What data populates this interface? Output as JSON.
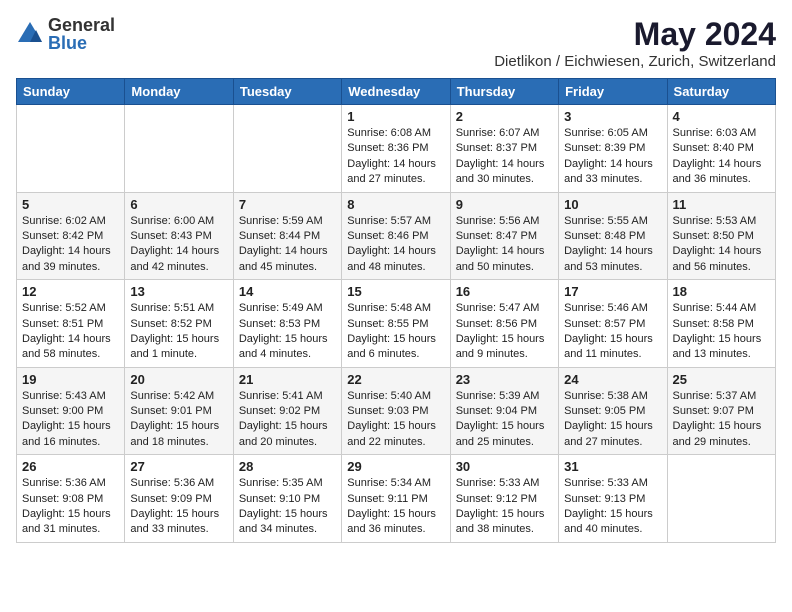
{
  "logo": {
    "general": "General",
    "blue": "Blue"
  },
  "title": "May 2024",
  "location": "Dietlikon / Eichwiesen, Zurich, Switzerland",
  "days_of_week": [
    "Sunday",
    "Monday",
    "Tuesday",
    "Wednesday",
    "Thursday",
    "Friday",
    "Saturday"
  ],
  "weeks": [
    [
      {
        "day": "",
        "data": ""
      },
      {
        "day": "",
        "data": ""
      },
      {
        "day": "",
        "data": ""
      },
      {
        "day": "1",
        "data": "Sunrise: 6:08 AM\nSunset: 8:36 PM\nDaylight: 14 hours and 27 minutes."
      },
      {
        "day": "2",
        "data": "Sunrise: 6:07 AM\nSunset: 8:37 PM\nDaylight: 14 hours and 30 minutes."
      },
      {
        "day": "3",
        "data": "Sunrise: 6:05 AM\nSunset: 8:39 PM\nDaylight: 14 hours and 33 minutes."
      },
      {
        "day": "4",
        "data": "Sunrise: 6:03 AM\nSunset: 8:40 PM\nDaylight: 14 hours and 36 minutes."
      }
    ],
    [
      {
        "day": "5",
        "data": "Sunrise: 6:02 AM\nSunset: 8:42 PM\nDaylight: 14 hours and 39 minutes."
      },
      {
        "day": "6",
        "data": "Sunrise: 6:00 AM\nSunset: 8:43 PM\nDaylight: 14 hours and 42 minutes."
      },
      {
        "day": "7",
        "data": "Sunrise: 5:59 AM\nSunset: 8:44 PM\nDaylight: 14 hours and 45 minutes."
      },
      {
        "day": "8",
        "data": "Sunrise: 5:57 AM\nSunset: 8:46 PM\nDaylight: 14 hours and 48 minutes."
      },
      {
        "day": "9",
        "data": "Sunrise: 5:56 AM\nSunset: 8:47 PM\nDaylight: 14 hours and 50 minutes."
      },
      {
        "day": "10",
        "data": "Sunrise: 5:55 AM\nSunset: 8:48 PM\nDaylight: 14 hours and 53 minutes."
      },
      {
        "day": "11",
        "data": "Sunrise: 5:53 AM\nSunset: 8:50 PM\nDaylight: 14 hours and 56 minutes."
      }
    ],
    [
      {
        "day": "12",
        "data": "Sunrise: 5:52 AM\nSunset: 8:51 PM\nDaylight: 14 hours and 58 minutes."
      },
      {
        "day": "13",
        "data": "Sunrise: 5:51 AM\nSunset: 8:52 PM\nDaylight: 15 hours and 1 minute."
      },
      {
        "day": "14",
        "data": "Sunrise: 5:49 AM\nSunset: 8:53 PM\nDaylight: 15 hours and 4 minutes."
      },
      {
        "day": "15",
        "data": "Sunrise: 5:48 AM\nSunset: 8:55 PM\nDaylight: 15 hours and 6 minutes."
      },
      {
        "day": "16",
        "data": "Sunrise: 5:47 AM\nSunset: 8:56 PM\nDaylight: 15 hours and 9 minutes."
      },
      {
        "day": "17",
        "data": "Sunrise: 5:46 AM\nSunset: 8:57 PM\nDaylight: 15 hours and 11 minutes."
      },
      {
        "day": "18",
        "data": "Sunrise: 5:44 AM\nSunset: 8:58 PM\nDaylight: 15 hours and 13 minutes."
      }
    ],
    [
      {
        "day": "19",
        "data": "Sunrise: 5:43 AM\nSunset: 9:00 PM\nDaylight: 15 hours and 16 minutes."
      },
      {
        "day": "20",
        "data": "Sunrise: 5:42 AM\nSunset: 9:01 PM\nDaylight: 15 hours and 18 minutes."
      },
      {
        "day": "21",
        "data": "Sunrise: 5:41 AM\nSunset: 9:02 PM\nDaylight: 15 hours and 20 minutes."
      },
      {
        "day": "22",
        "data": "Sunrise: 5:40 AM\nSunset: 9:03 PM\nDaylight: 15 hours and 22 minutes."
      },
      {
        "day": "23",
        "data": "Sunrise: 5:39 AM\nSunset: 9:04 PM\nDaylight: 15 hours and 25 minutes."
      },
      {
        "day": "24",
        "data": "Sunrise: 5:38 AM\nSunset: 9:05 PM\nDaylight: 15 hours and 27 minutes."
      },
      {
        "day": "25",
        "data": "Sunrise: 5:37 AM\nSunset: 9:07 PM\nDaylight: 15 hours and 29 minutes."
      }
    ],
    [
      {
        "day": "26",
        "data": "Sunrise: 5:36 AM\nSunset: 9:08 PM\nDaylight: 15 hours and 31 minutes."
      },
      {
        "day": "27",
        "data": "Sunrise: 5:36 AM\nSunset: 9:09 PM\nDaylight: 15 hours and 33 minutes."
      },
      {
        "day": "28",
        "data": "Sunrise: 5:35 AM\nSunset: 9:10 PM\nDaylight: 15 hours and 34 minutes."
      },
      {
        "day": "29",
        "data": "Sunrise: 5:34 AM\nSunset: 9:11 PM\nDaylight: 15 hours and 36 minutes."
      },
      {
        "day": "30",
        "data": "Sunrise: 5:33 AM\nSunset: 9:12 PM\nDaylight: 15 hours and 38 minutes."
      },
      {
        "day": "31",
        "data": "Sunrise: 5:33 AM\nSunset: 9:13 PM\nDaylight: 15 hours and 40 minutes."
      },
      {
        "day": "",
        "data": ""
      }
    ]
  ]
}
